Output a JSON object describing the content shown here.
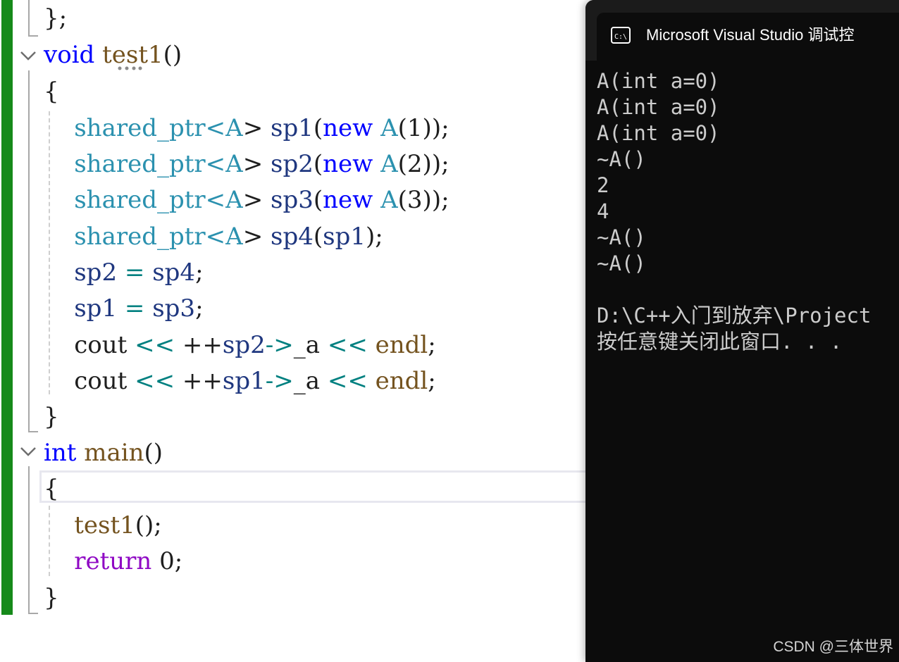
{
  "editor": {
    "lines": [
      [
        {
          "t": "};",
          "c": "pl"
        }
      ],
      [
        {
          "t": "void",
          "c": "kw"
        },
        {
          "t": " ",
          "c": "pl"
        },
        {
          "t": "test1",
          "c": "fn"
        },
        {
          "t": "()",
          "c": "pl"
        }
      ],
      [
        {
          "t": "{",
          "c": "pl"
        }
      ],
      [
        {
          "t": "    ",
          "c": "pl"
        },
        {
          "t": "shared_ptr",
          "c": "type"
        },
        {
          "t": "<",
          "c": "type"
        },
        {
          "t": "A",
          "c": "type"
        },
        {
          "t": "> ",
          "c": "pl"
        },
        {
          "t": "sp1",
          "c": "var"
        },
        {
          "t": "(",
          "c": "pl"
        },
        {
          "t": "new",
          "c": "kw"
        },
        {
          "t": " ",
          "c": "pl"
        },
        {
          "t": "A",
          "c": "type"
        },
        {
          "t": "(1));",
          "c": "pl"
        }
      ],
      [
        {
          "t": "    ",
          "c": "pl"
        },
        {
          "t": "shared_ptr",
          "c": "type"
        },
        {
          "t": "<",
          "c": "type"
        },
        {
          "t": "A",
          "c": "type"
        },
        {
          "t": "> ",
          "c": "pl"
        },
        {
          "t": "sp2",
          "c": "var"
        },
        {
          "t": "(",
          "c": "pl"
        },
        {
          "t": "new",
          "c": "kw"
        },
        {
          "t": " ",
          "c": "pl"
        },
        {
          "t": "A",
          "c": "type"
        },
        {
          "t": "(2));",
          "c": "pl"
        }
      ],
      [
        {
          "t": "    ",
          "c": "pl"
        },
        {
          "t": "shared_ptr",
          "c": "type"
        },
        {
          "t": "<",
          "c": "type"
        },
        {
          "t": "A",
          "c": "type"
        },
        {
          "t": "> ",
          "c": "pl"
        },
        {
          "t": "sp3",
          "c": "var"
        },
        {
          "t": "(",
          "c": "pl"
        },
        {
          "t": "new",
          "c": "kw"
        },
        {
          "t": " ",
          "c": "pl"
        },
        {
          "t": "A",
          "c": "type"
        },
        {
          "t": "(3));",
          "c": "pl"
        }
      ],
      [
        {
          "t": "    ",
          "c": "pl"
        },
        {
          "t": "shared_ptr",
          "c": "type"
        },
        {
          "t": "<",
          "c": "type"
        },
        {
          "t": "A",
          "c": "type"
        },
        {
          "t": "> ",
          "c": "pl"
        },
        {
          "t": "sp4",
          "c": "var"
        },
        {
          "t": "(",
          "c": "pl"
        },
        {
          "t": "sp1",
          "c": "var"
        },
        {
          "t": ");",
          "c": "pl"
        }
      ],
      [
        {
          "t": "    ",
          "c": "pl"
        },
        {
          "t": "sp2",
          "c": "var"
        },
        {
          "t": " ",
          "c": "pl"
        },
        {
          "t": "=",
          "c": "op"
        },
        {
          "t": " ",
          "c": "pl"
        },
        {
          "t": "sp4",
          "c": "var"
        },
        {
          "t": ";",
          "c": "pl"
        }
      ],
      [
        {
          "t": "    ",
          "c": "pl"
        },
        {
          "t": "sp1",
          "c": "var"
        },
        {
          "t": " ",
          "c": "pl"
        },
        {
          "t": "=",
          "c": "op"
        },
        {
          "t": " ",
          "c": "pl"
        },
        {
          "t": "sp3",
          "c": "var"
        },
        {
          "t": ";",
          "c": "pl"
        }
      ],
      [
        {
          "t": "    cout ",
          "c": "pl"
        },
        {
          "t": "<<",
          "c": "op"
        },
        {
          "t": " ++",
          "c": "pl"
        },
        {
          "t": "sp2",
          "c": "var"
        },
        {
          "t": "->",
          "c": "op"
        },
        {
          "t": "_a ",
          "c": "pl"
        },
        {
          "t": "<<",
          "c": "op"
        },
        {
          "t": " ",
          "c": "pl"
        },
        {
          "t": "endl",
          "c": "fn"
        },
        {
          "t": ";",
          "c": "pl"
        }
      ],
      [
        {
          "t": "    cout ",
          "c": "pl"
        },
        {
          "t": "<<",
          "c": "op"
        },
        {
          "t": " ++",
          "c": "pl"
        },
        {
          "t": "sp1",
          "c": "var"
        },
        {
          "t": "->",
          "c": "op"
        },
        {
          "t": "_a ",
          "c": "pl"
        },
        {
          "t": "<<",
          "c": "op"
        },
        {
          "t": " ",
          "c": "pl"
        },
        {
          "t": "endl",
          "c": "fn"
        },
        {
          "t": ";",
          "c": "pl"
        }
      ],
      [
        {
          "t": "}",
          "c": "pl"
        }
      ],
      [
        {
          "t": "int",
          "c": "kw"
        },
        {
          "t": " ",
          "c": "pl"
        },
        {
          "t": "main",
          "c": "fn"
        },
        {
          "t": "()",
          "c": "pl"
        }
      ],
      [
        {
          "t": "{",
          "c": "pl"
        }
      ],
      [
        {
          "t": "    ",
          "c": "pl"
        },
        {
          "t": "test1",
          "c": "fn"
        },
        {
          "t": "();",
          "c": "pl"
        }
      ],
      [
        {
          "t": "    ",
          "c": "pl"
        },
        {
          "t": "return",
          "c": "ctl"
        },
        {
          "t": " 0;",
          "c": "pl"
        }
      ],
      [
        {
          "t": "}",
          "c": "pl"
        }
      ]
    ],
    "colors": {
      "change_bar": "#168a1a",
      "keyword": "#0000ff",
      "type": "#2b91af",
      "function": "#74531f",
      "variable": "#1f377f",
      "operator": "#008080",
      "control": "#8f08c4"
    }
  },
  "console": {
    "title": "Microsoft Visual Studio 调试控",
    "icon": "console-icon",
    "output": [
      "A(int a=0)",
      "A(int a=0)",
      "A(int a=0)",
      "~A()",
      "2",
      "4",
      "~A()",
      "~A()",
      "",
      "D:\\C++入门到放弃\\Project",
      "按任意键关闭此窗口. . ."
    ]
  },
  "watermark": "CSDN @三体世界"
}
